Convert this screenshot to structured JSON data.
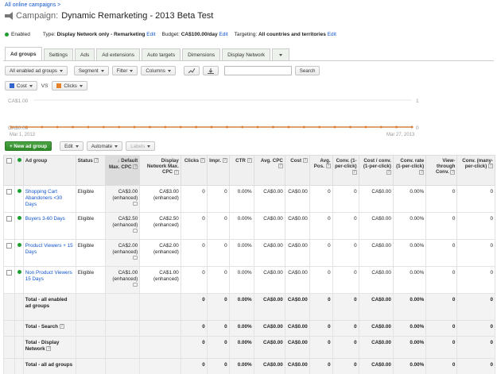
{
  "breadcrumb": "All online campaigns >",
  "campaign": {
    "label": "Campaign:",
    "name": "Dynamic Remarketing - 2013 Beta Test"
  },
  "status": {
    "enabled": "Enabled",
    "type_label": "Type:",
    "type_value": "Display Network only - Remarketing",
    "type_edit": "Edit",
    "budget_label": "Budget:",
    "budget_value": "CA$100.00/day",
    "budget_edit": "Edit",
    "targeting_label": "Targeting:",
    "targeting_value": "All countries and territories",
    "targeting_edit": "Edit"
  },
  "tabs": [
    "Ad groups",
    "Settings",
    "Ads",
    "Ad extensions",
    "Auto targets",
    "Dimensions",
    "Display Network"
  ],
  "toolbar": {
    "filter_groups": "All enabled ad groups",
    "segment": "Segment",
    "filter": "Filter",
    "columns": "Columns",
    "search": "Search"
  },
  "metrics": {
    "metric1": "Cost",
    "vs": "VS",
    "metric2": "Clicks",
    "metric1_color": "#3366cc",
    "metric2_color": "#e8822a"
  },
  "chart_data": {
    "type": "line",
    "y_left_labels": [
      "CA$1.00",
      "CA$0.00"
    ],
    "y_right_labels": [
      "1",
      "0"
    ],
    "x_start": "Mar 1, 2013",
    "x_end": "Mar 27, 2013",
    "series": [
      {
        "values": [
          0,
          0,
          0,
          0,
          0,
          0,
          0,
          0,
          0,
          0,
          0,
          0,
          0,
          0,
          0,
          0,
          0,
          0,
          0,
          0,
          0,
          0,
          0,
          0,
          0,
          0,
          0
        ]
      },
      {
        "values": [
          0,
          0,
          0,
          0,
          0,
          0,
          0,
          0,
          0,
          0,
          0,
          0,
          0,
          0,
          0,
          0,
          0,
          0,
          0,
          0,
          0,
          0,
          0,
          0,
          0,
          0,
          0
        ]
      }
    ],
    "ylim_left": [
      0,
      1
    ],
    "ylim_right": [
      0,
      1
    ],
    "grid": true
  },
  "actions": {
    "new": "+ New ad group",
    "edit": "Edit",
    "automate": "Automate",
    "labels": "Labels"
  },
  "columns": [
    {
      "key": "adgroup",
      "label": "Ad group"
    },
    {
      "key": "status",
      "label": "Status"
    },
    {
      "key": "defcpc",
      "label": "Default Max. CPC"
    },
    {
      "key": "dncpc",
      "label": "Display Network Max. CPC"
    },
    {
      "key": "clicks",
      "label": "Clicks"
    },
    {
      "key": "impr",
      "label": "Impr."
    },
    {
      "key": "ctr",
      "label": "CTR"
    },
    {
      "key": "avgcpc",
      "label": "Avg. CPC"
    },
    {
      "key": "cost",
      "label": "Cost"
    },
    {
      "key": "avgpos",
      "label": "Avg. Pos."
    },
    {
      "key": "conv",
      "label": "Conv. (1-per-click)"
    },
    {
      "key": "costconv",
      "label": "Cost / conv. (1-per-click)"
    },
    {
      "key": "convrate",
      "label": "Conv. rate (1-per-click)"
    },
    {
      "key": "vtc",
      "label": "View-through Conv."
    },
    {
      "key": "convmany",
      "label": "Conv. (many-per-click)"
    }
  ],
  "rows": [
    {
      "name": "Shopping Cart Abandoners <30 Days",
      "status": "Eligible",
      "defcpc": "CA$3.00",
      "defcpc_note": "(enhanced)",
      "dncpc": "CA$3.00",
      "dncpc_note": "(enhanced)",
      "clicks": "0",
      "impr": "0",
      "ctr": "0.00%",
      "avgcpc": "CA$0.00",
      "cost": "CA$0.00",
      "avgpos": "0",
      "conv": "0",
      "costconv": "CA$0.00",
      "convrate": "0.00%",
      "vtc": "0",
      "convmany": "0"
    },
    {
      "name": "Buyers 3-60 Days",
      "status": "Eligible",
      "defcpc": "CA$2.50",
      "defcpc_note": "(enhanced)",
      "dncpc": "CA$2.50",
      "dncpc_note": "(enhanced)",
      "clicks": "0",
      "impr": "0",
      "ctr": "0.00%",
      "avgcpc": "CA$0.00",
      "cost": "CA$0.00",
      "avgpos": "0",
      "conv": "0",
      "costconv": "CA$0.00",
      "convrate": "0.00%",
      "vtc": "0",
      "convmany": "0"
    },
    {
      "name": "Product Viewers + 15 Days",
      "status": "Eligible",
      "defcpc": "CA$2.00",
      "defcpc_note": "(enhanced)",
      "dncpc": "CA$2.00",
      "dncpc_note": "(enhanced)",
      "clicks": "0",
      "impr": "0",
      "ctr": "0.00%",
      "avgcpc": "CA$0.00",
      "cost": "CA$0.00",
      "avgpos": "0",
      "conv": "0",
      "costconv": "CA$0.00",
      "convrate": "0.00%",
      "vtc": "0",
      "convmany": "0"
    },
    {
      "name": "Non Product Viewers 15 Days",
      "status": "Eligible",
      "defcpc": "CA$1.00",
      "defcpc_note": "(enhanced)",
      "dncpc": "CA$1.00",
      "dncpc_note": "(enhanced)",
      "clicks": "0",
      "impr": "0",
      "ctr": "0.00%",
      "avgcpc": "CA$0.00",
      "cost": "CA$0.00",
      "avgpos": "0",
      "conv": "0",
      "costconv": "CA$0.00",
      "convrate": "0.00%",
      "vtc": "0",
      "convmany": "0"
    }
  ],
  "totals": [
    {
      "label": "Total - all enabled ad groups",
      "clicks": "0",
      "impr": "0",
      "ctr": "0.00%",
      "avgcpc": "CA$0.00",
      "cost": "CA$0.00",
      "avgpos": "0",
      "conv": "0",
      "costconv": "CA$0.00",
      "convrate": "0.00%",
      "vtc": "0",
      "convmany": "0"
    },
    {
      "label": "Total - Search",
      "clicks": "0",
      "impr": "0",
      "ctr": "0.00%",
      "avgcpc": "CA$0.00",
      "cost": "CA$0.00",
      "avgpos": "0",
      "conv": "0",
      "costconv": "CA$0.00",
      "convrate": "0.00%",
      "vtc": "0",
      "convmany": "0"
    },
    {
      "label": "Total - Display Network",
      "clicks": "0",
      "impr": "0",
      "ctr": "0.00%",
      "avgcpc": "CA$0.00",
      "cost": "CA$0.00",
      "avgpos": "0",
      "conv": "0",
      "costconv": "CA$0.00",
      "convrate": "0.00%",
      "vtc": "0",
      "convmany": "0"
    },
    {
      "label": "Total - all ad groups",
      "clicks": "0",
      "impr": "0",
      "ctr": "0.00%",
      "avgcpc": "CA$0.00",
      "cost": "CA$0.00",
      "avgpos": "0",
      "conv": "0",
      "costconv": "CA$0.00",
      "convrate": "0.00%",
      "vtc": "0",
      "convmany": "0"
    }
  ]
}
